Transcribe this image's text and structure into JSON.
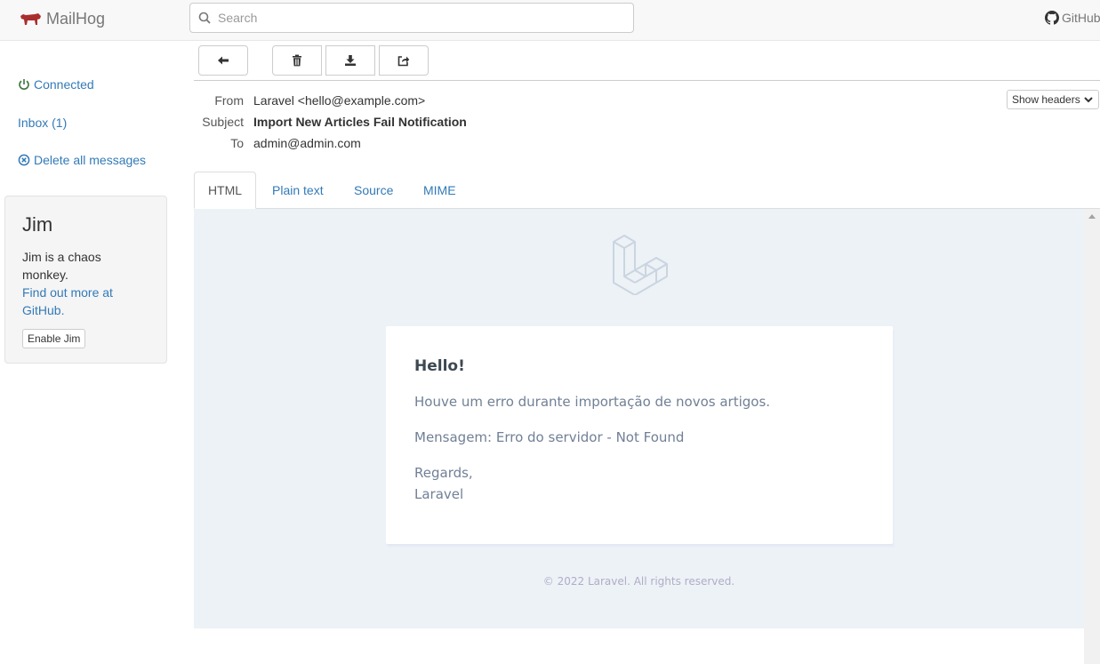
{
  "app": {
    "name": "MailHog"
  },
  "search": {
    "placeholder": "Search"
  },
  "header": {
    "github_label": "GitHub"
  },
  "sidebar": {
    "status": "Connected",
    "inbox": "Inbox (1)",
    "delete_all": "Delete all messages",
    "jim": {
      "title": "Jim",
      "description": "Jim is a chaos monkey.",
      "link": "Find out more at GitHub.",
      "button": "Enable Jim"
    }
  },
  "toolbar": {
    "back_icon": "arrow-left-icon",
    "delete_icon": "trash-icon",
    "download_icon": "download-icon",
    "release_icon": "share-icon"
  },
  "message": {
    "from_label": "From",
    "from_value": "Laravel <hello@example.com>",
    "subject_label": "Subject",
    "subject_value": "Import New Articles Fail Notification",
    "to_label": "To",
    "to_value": "admin@admin.com",
    "show_headers": "Show headers"
  },
  "tabs": [
    {
      "label": "HTML",
      "active": true
    },
    {
      "label": "Plain text",
      "active": false
    },
    {
      "label": "Source",
      "active": false
    },
    {
      "label": "MIME",
      "active": false
    }
  ],
  "email_body": {
    "greeting": "Hello!",
    "line1": "Houve um erro durante importação de novos artigos.",
    "line2": "Mensagem: Erro do servidor - Not Found",
    "regards": "Regards,",
    "signature": "Laravel",
    "footer": "© 2022 Laravel. All rights reserved."
  },
  "colors": {
    "link": "#337ab7",
    "connected": "#3c763d",
    "brand_pig": "#a92f2f",
    "email_bg": "#edf2f7"
  }
}
